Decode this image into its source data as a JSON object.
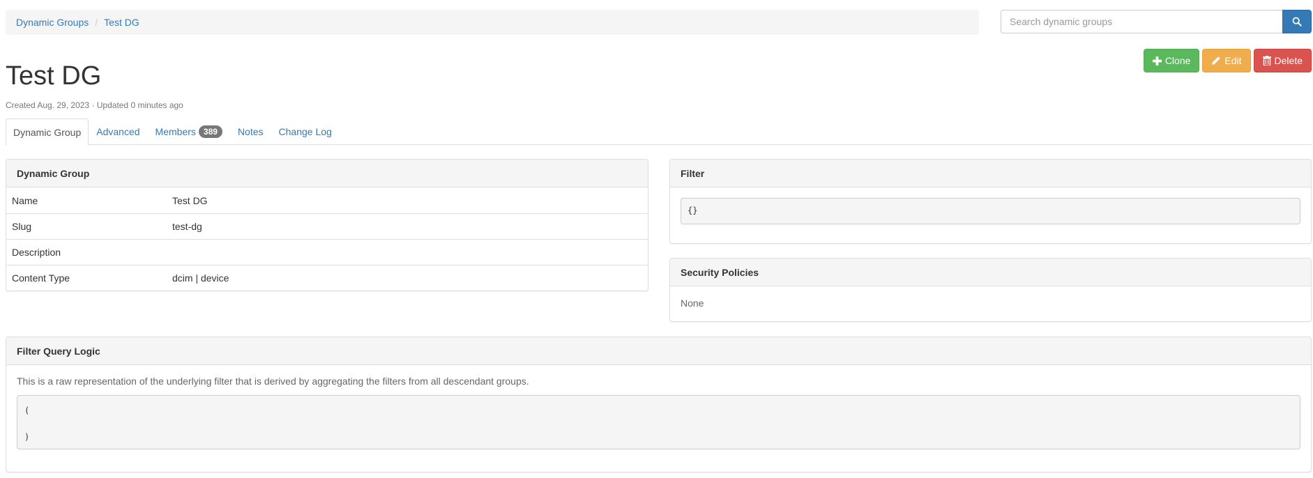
{
  "breadcrumb": {
    "items": [
      "Dynamic Groups",
      "Test DG"
    ],
    "separator": "/"
  },
  "search": {
    "placeholder": "Search dynamic groups",
    "icon": "search-icon"
  },
  "actions": {
    "clone_label": "Clone",
    "edit_label": "Edit",
    "delete_label": "Delete"
  },
  "page": {
    "title": "Test DG",
    "meta": "Created Aug. 29, 2023 · Updated 0 minutes ago"
  },
  "tabs": [
    {
      "label": "Dynamic Group",
      "active": true
    },
    {
      "label": "Advanced"
    },
    {
      "label": "Members",
      "badge": "389"
    },
    {
      "label": "Notes"
    },
    {
      "label": "Change Log"
    }
  ],
  "dynamic_group_panel": {
    "title": "Dynamic Group",
    "rows": [
      {
        "key": "Name",
        "value": "Test DG"
      },
      {
        "key": "Slug",
        "value": "test-dg"
      },
      {
        "key": "Description",
        "value": ""
      },
      {
        "key": "Content Type",
        "value": "dcim | device"
      }
    ]
  },
  "filter_panel": {
    "title": "Filter",
    "code": "{}"
  },
  "security_panel": {
    "title": "Security Policies",
    "value": "None"
  },
  "query_logic_panel": {
    "title": "Filter Query Logic",
    "description": "This is a raw representation of the underlying filter that is derived by aggregating the filters from all descendant groups.",
    "code_open": "(",
    "code_close": ")"
  },
  "colors": {
    "link": "#337ab7",
    "success": "#5cb85c",
    "warning": "#f0ad4e",
    "danger": "#d9534f",
    "badge": "#777777"
  }
}
